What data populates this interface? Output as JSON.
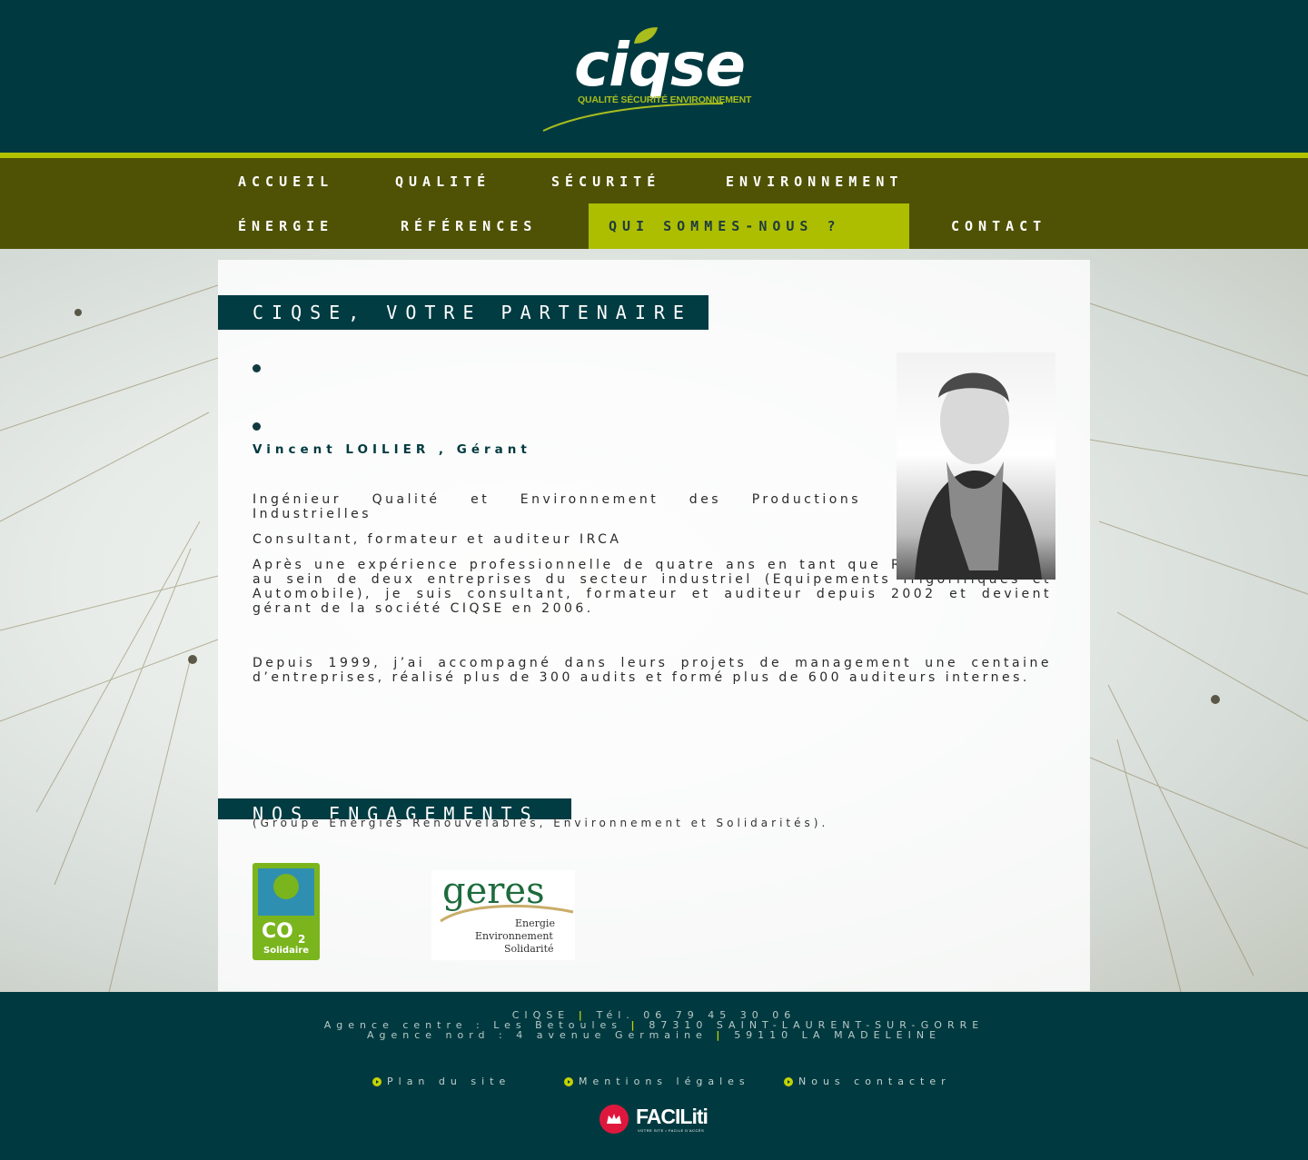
{
  "header": {
    "logo_word": "ciqse",
    "logo_tagline": "QUALITÉ SÉCURITÉ ENVIRONNEMENT"
  },
  "nav": {
    "items": [
      {
        "label": "ACCUEIL"
      },
      {
        "label": "QUALITÉ"
      },
      {
        "label": "SÉCURITÉ"
      },
      {
        "label": "ENVIRONNEMENT"
      },
      {
        "label": "ÉNERGIE"
      },
      {
        "label": "RÉFÉRENCES"
      },
      {
        "label": "QUI SOMMES-NOUS ?"
      },
      {
        "label": "CONTACT"
      }
    ],
    "active": "QUI SOMMES-NOUS ?"
  },
  "main": {
    "title": "CIQSE, VOTRE PARTENAIRE",
    "person_name": "Vincent LOILIER , Gérant",
    "paragraphs": [
      "Ingénieur Qualité et Environnement des Productions Industrielles",
      "Consultant, formateur et auditeur IRCA",
      "Après une expérience professionnelle de quatre ans en tant que Responsable QSE au sein de deux entreprises du secteur industriel (Equipements frigorifiques et Automobile), je suis consultant, formateur et auditeur depuis 2002 et devient gérant de la société CIQSE en 2006.",
      "Depuis 1999, j’ai accompagné dans leurs projets de management une centaine d’entreprises, réalisé plus de 300 audits et formé plus de 600 auditeurs internes."
    ],
    "commitments_title": "NOS ENGAGEMENTS",
    "commitments_note": "(Groupe Energies Renouvelables, Environnement et Solidarités).",
    "co2_logo": {
      "line1": "CO",
      "sub": "2",
      "line2": "Solidaire"
    },
    "geres_logo": {
      "word": "geres",
      "line1": "Energie",
      "line2": "Environnement",
      "line3": "Solidarité"
    }
  },
  "footer": {
    "line1": [
      "CIQSE",
      "Tél. 06 79 45 30 06"
    ],
    "line2": [
      "Agence centre : Les Betoules",
      "87310 SAINT-LAURENT-SUR-GORRE"
    ],
    "line3": [
      "Agence nord : 4 avenue Germaine",
      "59110 LA MADELEINE"
    ],
    "links": [
      "Plan du site",
      "Mentions légales",
      "Nous contacter"
    ],
    "faciliti": "FACILiti",
    "faciliti_tagline": "VOTRE SITE • FACILE D'ACCÈS"
  },
  "colors": {
    "dark_teal": "#003a40",
    "olive": "#4f5204",
    "lime": "#adbe00"
  }
}
